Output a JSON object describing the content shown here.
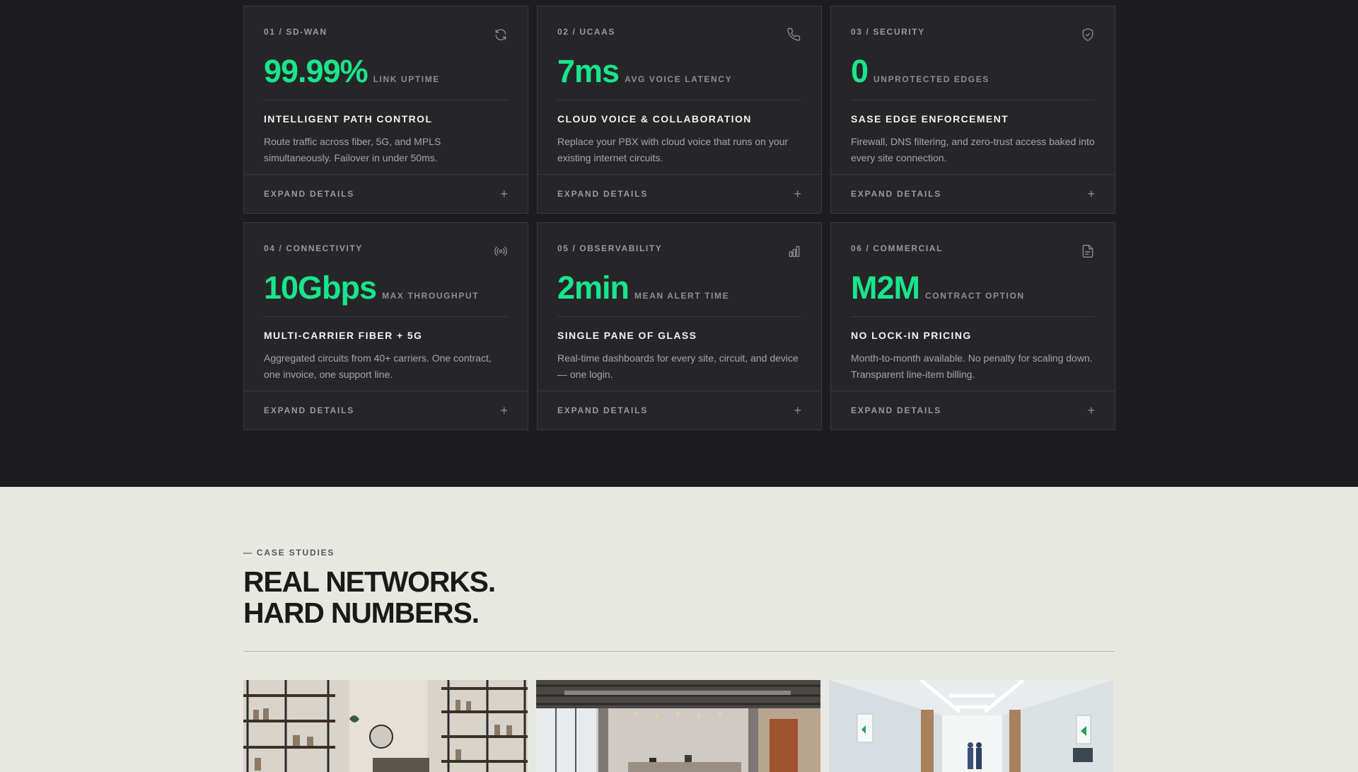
{
  "cards": [
    {
      "eyebrow": "01 / SD-WAN",
      "icon": "refresh-icon",
      "metric": "99.99%",
      "metric_label": "LINK UPTIME",
      "title": "INTELLIGENT PATH CONTROL",
      "desc": "Route traffic across fiber, 5G, and MPLS simultaneously. Failover in under 50ms.",
      "expand": "EXPAND DETAILS"
    },
    {
      "eyebrow": "02 / UCAAS",
      "icon": "phone-icon",
      "metric": "7ms",
      "metric_label": "AVG VOICE LATENCY",
      "title": "CLOUD VOICE & COLLABORATION",
      "desc": "Replace your PBX with cloud voice that runs on your existing internet circuits.",
      "expand": "EXPAND DETAILS"
    },
    {
      "eyebrow": "03 / SECURITY",
      "icon": "shield-icon",
      "metric": "0",
      "metric_label": "UNPROTECTED EDGES",
      "title": "SASE EDGE ENFORCEMENT",
      "desc": "Firewall, DNS filtering, and zero-trust access baked into every site connection.",
      "expand": "EXPAND DETAILS"
    },
    {
      "eyebrow": "04 / CONNECTIVITY",
      "icon": "broadcast-icon",
      "metric": "10Gbps",
      "metric_label": "MAX THROUGHPUT",
      "title": "MULTI-CARRIER FIBER + 5G",
      "desc": "Aggregated circuits from 40+ carriers. One contract, one invoice, one support line.",
      "expand": "EXPAND DETAILS"
    },
    {
      "eyebrow": "05 / OBSERVABILITY",
      "icon": "bar-chart-icon",
      "metric": "2min",
      "metric_label": "MEAN ALERT TIME",
      "title": "SINGLE PANE OF GLASS",
      "desc": "Real-time dashboards for every site, circuit, and device — one login.",
      "expand": "EXPAND DETAILS"
    },
    {
      "eyebrow": "06 / COMMERCIAL",
      "icon": "document-icon",
      "metric": "M2M",
      "metric_label": "CONTRACT OPTION",
      "title": "NO LOCK-IN PRICING",
      "desc": "Month-to-month available. No penalty for scaling down. Transparent line-item billing.",
      "expand": "EXPAND DETAILS"
    }
  ],
  "case_studies": {
    "kicker": "— CASE STUDIES",
    "headline_line1": "REAL NETWORKS.",
    "headline_line2": "HARD NUMBERS.",
    "photos": [
      "retail-store-photo",
      "open-office-photo",
      "hospital-corridor-photo"
    ]
  },
  "colors": {
    "accent": "#19e58c",
    "dark_bg": "#1d1d1f",
    "card_bg": "#262628",
    "light_bg": "#e8e8e3"
  }
}
